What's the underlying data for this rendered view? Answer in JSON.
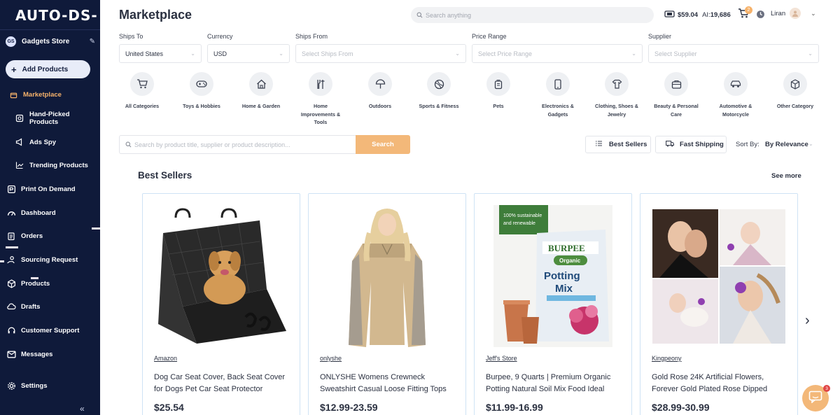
{
  "app": {
    "logo": "AUTO-DS-"
  },
  "sidebar": {
    "store_badge": "GS",
    "store_name": "Gadgets Store",
    "add_products": "Add Products",
    "items": [
      {
        "label": "Marketplace",
        "icon": "store-icon"
      },
      {
        "label": "Hand-Picked Products",
        "icon": "hand-picked-icon"
      },
      {
        "label": "Ads Spy",
        "icon": "megaphone-icon"
      },
      {
        "label": "Trending Products",
        "icon": "trend-icon"
      },
      {
        "label": "Print On Demand",
        "icon": "print-icon"
      },
      {
        "label": "Dashboard",
        "icon": "gauge-icon"
      },
      {
        "label": "Orders",
        "icon": "clipboard-icon"
      },
      {
        "label": "Sourcing Request",
        "icon": "sourcing-icon"
      },
      {
        "label": "Products",
        "icon": "box-icon"
      },
      {
        "label": "Drafts",
        "icon": "cloud-icon"
      },
      {
        "label": "Customer Support",
        "icon": "headset-icon"
      },
      {
        "label": "Messages",
        "icon": "mail-icon"
      },
      {
        "label": "Settings",
        "icon": "gear-icon"
      }
    ]
  },
  "header": {
    "title": "Marketplace",
    "search_placeholder": "Search anything",
    "balance": "$59.04",
    "ai_label": "AI:",
    "ai_credits": "19,686",
    "cart_count": "2",
    "user_name": "Liran"
  },
  "filters": {
    "ships_to": {
      "label": "Ships To",
      "value": "United States"
    },
    "currency": {
      "label": "Currency",
      "value": "USD"
    },
    "ships_from": {
      "label": "Ships From",
      "placeholder": "Select Ships From"
    },
    "price_range": {
      "label": "Price Range",
      "placeholder": "Select Price Range"
    },
    "supplier": {
      "label": "Supplier",
      "placeholder": "Select Supplier"
    }
  },
  "categories": [
    {
      "l1": "All Categories",
      "l2": "",
      "l3": "",
      "icon": "cart-icon"
    },
    {
      "l1": "Toys & Hobbies",
      "l2": "",
      "l3": "",
      "icon": "gamepad-icon"
    },
    {
      "l1": "Home & Garden",
      "l2": "",
      "l3": "",
      "icon": "house-icon"
    },
    {
      "l1": "Home",
      "l2": "Improvements &",
      "l3": "Tools",
      "icon": "tools-icon"
    },
    {
      "l1": "Outdoors",
      "l2": "",
      "l3": "",
      "icon": "umbrella-icon"
    },
    {
      "l1": "Sports & Fitness",
      "l2": "",
      "l3": "",
      "icon": "ball-icon"
    },
    {
      "l1": "Pets",
      "l2": "",
      "l3": "",
      "icon": "pet-icon"
    },
    {
      "l1": "Electronics &",
      "l2": "Gadgets",
      "l3": "",
      "icon": "phone-icon"
    },
    {
      "l1": "Clothing, Shoes &",
      "l2": "Jewelry",
      "l3": "",
      "icon": "shirt-icon"
    },
    {
      "l1": "Beauty & Personal",
      "l2": "Care",
      "l3": "",
      "icon": "bag-icon"
    },
    {
      "l1": "Automotive &",
      "l2": "Motorcycle",
      "l3": "",
      "icon": "car-icon"
    },
    {
      "l1": "Other Category",
      "l2": "",
      "l3": "",
      "icon": "cube-icon"
    }
  ],
  "product_search": {
    "placeholder": "Search by product title, supplier or product description...",
    "button": "Search",
    "best_sellers": "Best Sellers",
    "fast_shipping": "Fast Shipping",
    "sort_label": "Sort By:",
    "sort_value": "By Relevance"
  },
  "section": {
    "title": "Best Sellers",
    "see_more": "See more"
  },
  "products": [
    {
      "supplier": "Amazon",
      "title": "Dog Car Seat Cover, Back Seat Cover for Dogs Pet Car Seat Protector Waterproof...",
      "price": "$25.54"
    },
    {
      "supplier": "onlyshe",
      "title": "ONLYSHE Womens Crewneck Sweatshirt Casual Loose Fitting Tops Long Sleeve ...",
      "price": "$12.99-23.59"
    },
    {
      "supplier": "Jeff's Store",
      "title": "Burpee, 9 Quarts | Premium Organic Potting Natural Soil Mix Food Ideal for...",
      "price": "$11.99-16.99",
      "banner_l1": "100% sustainable",
      "banner_l2": "and renewable",
      "brand": "BURPEE",
      "badge": "Organic",
      "bag_title_l1": "Potting",
      "bag_title_l2": "Mix"
    },
    {
      "supplier": "Kingpeony",
      "title": "Gold Rose 24K Artificial Flowers, Forever Gold Plated Rose Dipped Rose with...",
      "price": "$28.99-30.99"
    }
  ],
  "chat_badge": "3"
}
